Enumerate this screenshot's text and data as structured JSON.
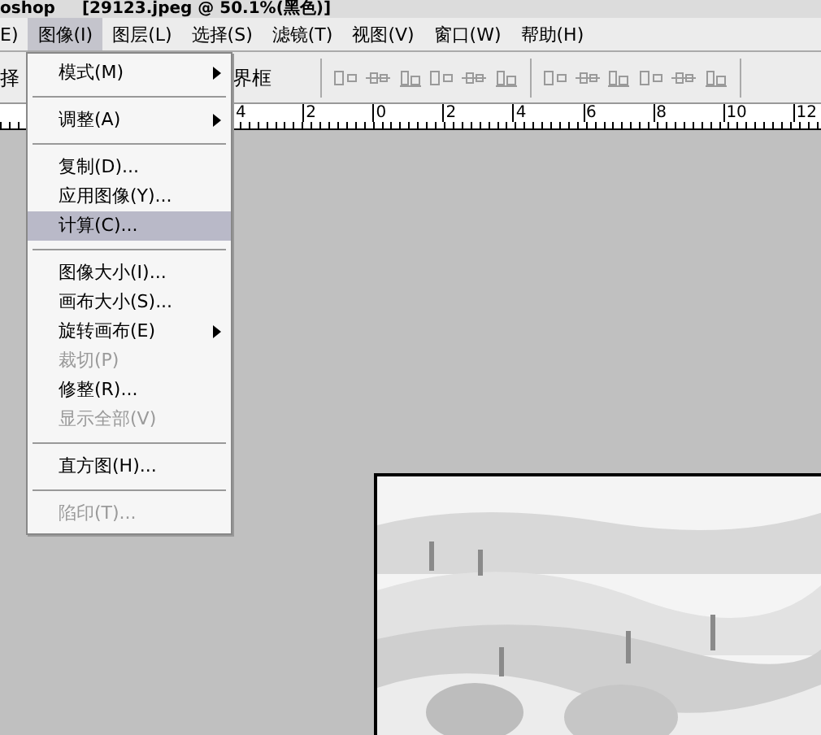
{
  "title_bar": {
    "app": "oshop",
    "document": "[29123.jpeg @ 50.1%(黑色)]"
  },
  "menu_bar": [
    {
      "label": "E)",
      "selected": false
    },
    {
      "label": "图像(I)",
      "selected": true
    },
    {
      "label": "图层(L)",
      "selected": false
    },
    {
      "label": "选择(S)",
      "selected": false
    },
    {
      "label": "滤镜(T)",
      "selected": false
    },
    {
      "label": "视图(V)",
      "selected": false
    },
    {
      "label": "窗口(W)",
      "selected": false
    },
    {
      "label": "帮助(H)",
      "selected": false
    }
  ],
  "options_bar": {
    "left_label": "择",
    "right_label": "界框"
  },
  "ruler": [
    "4",
    "2",
    "0",
    "2",
    "4",
    "6",
    "8",
    "10",
    "12"
  ],
  "image_menu": [
    {
      "kind": "item",
      "label": "模式(M)",
      "submenu": true,
      "disabled": false,
      "selected": false
    },
    {
      "kind": "separator"
    },
    {
      "kind": "item",
      "label": "调整(A)",
      "submenu": true,
      "disabled": false,
      "selected": false
    },
    {
      "kind": "separator"
    },
    {
      "kind": "item",
      "label": "复制(D)...",
      "submenu": false,
      "disabled": false,
      "selected": false
    },
    {
      "kind": "item",
      "label": "应用图像(Y)...",
      "submenu": false,
      "disabled": false,
      "selected": false
    },
    {
      "kind": "item",
      "label": "计算(C)...",
      "submenu": false,
      "disabled": false,
      "selected": true
    },
    {
      "kind": "separator"
    },
    {
      "kind": "item",
      "label": "图像大小(I)...",
      "submenu": false,
      "disabled": false,
      "selected": false
    },
    {
      "kind": "item",
      "label": "画布大小(S)...",
      "submenu": false,
      "disabled": false,
      "selected": false
    },
    {
      "kind": "item",
      "label": "旋转画布(E)",
      "submenu": true,
      "disabled": false,
      "selected": false
    },
    {
      "kind": "item",
      "label": "裁切(P)",
      "submenu": false,
      "disabled": true,
      "selected": false
    },
    {
      "kind": "item",
      "label": "修整(R)...",
      "submenu": false,
      "disabled": false,
      "selected": false
    },
    {
      "kind": "item",
      "label": "显示全部(V)",
      "submenu": false,
      "disabled": true,
      "selected": false
    },
    {
      "kind": "separator"
    },
    {
      "kind": "item",
      "label": "直方图(H)...",
      "submenu": false,
      "disabled": false,
      "selected": false
    },
    {
      "kind": "separator"
    },
    {
      "kind": "item",
      "label": "陷印(T)...",
      "submenu": false,
      "disabled": true,
      "selected": false
    }
  ]
}
